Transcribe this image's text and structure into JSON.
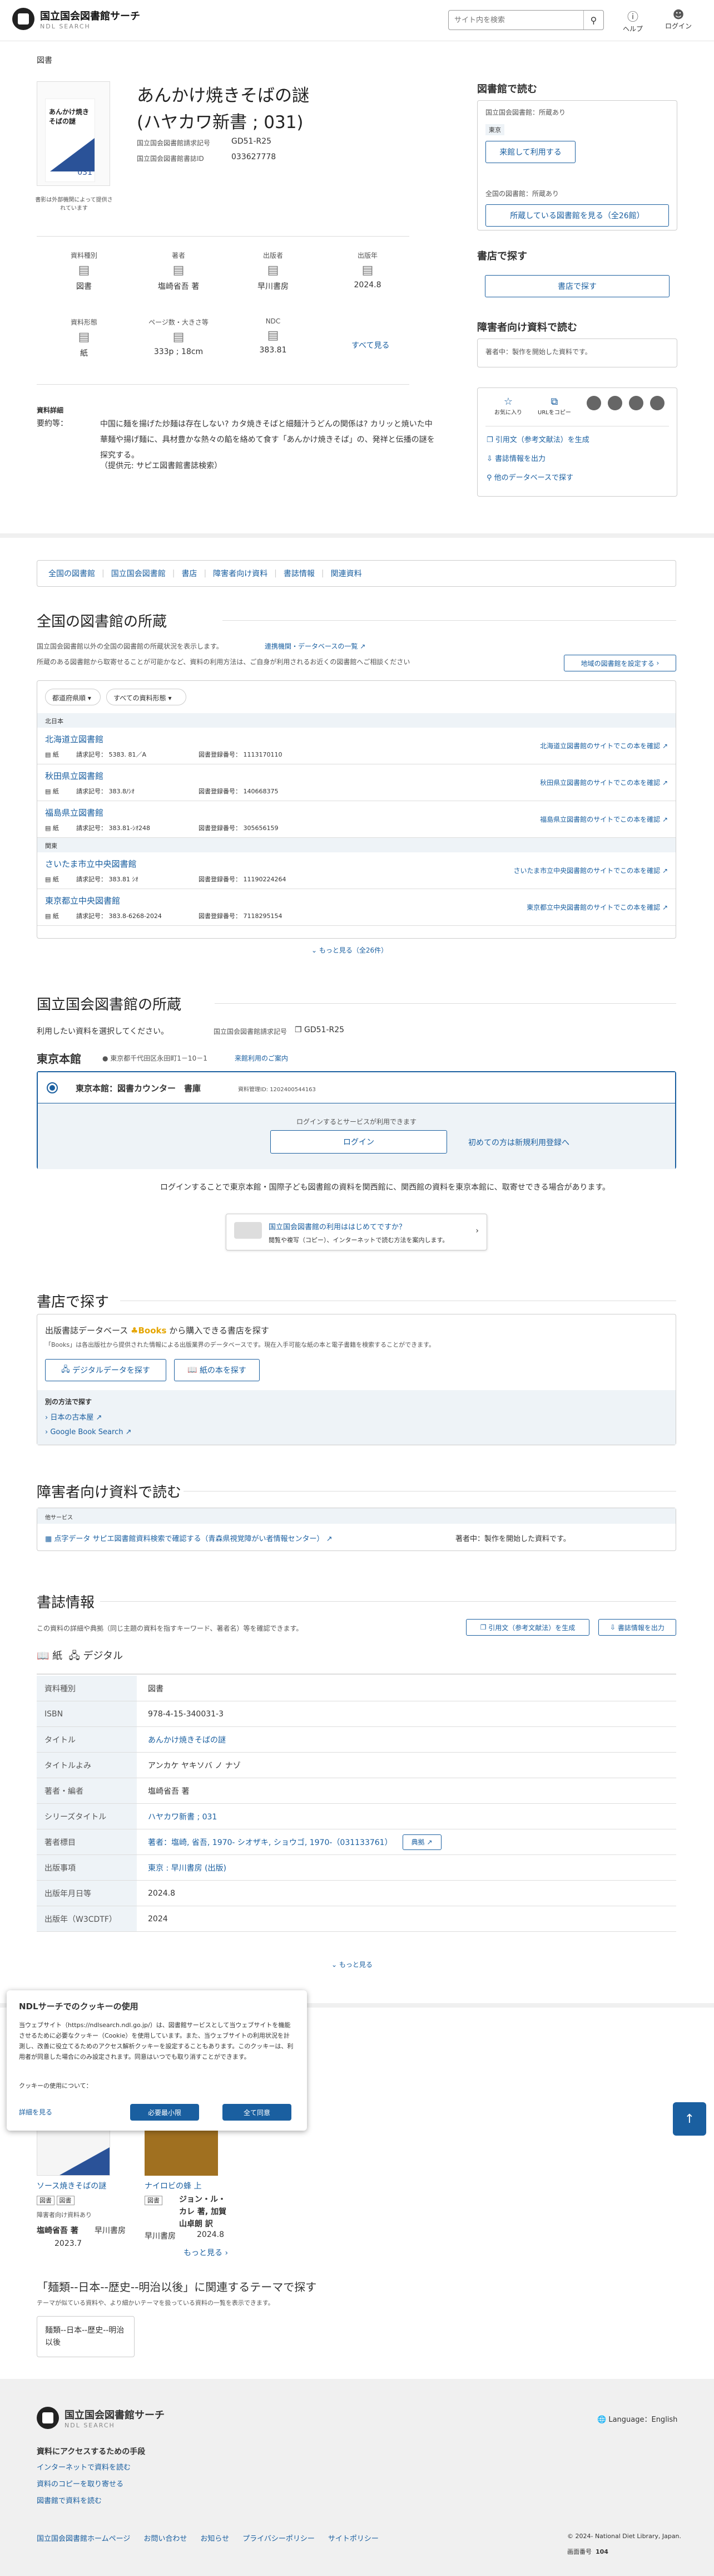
{
  "header": {
    "logo_title": "国立国会図書館サーチ",
    "logo_sub": "NDL SEARCH",
    "search_placeholder": "サイト内を検索",
    "help": "ヘルプ",
    "login": "ログイン"
  },
  "book": {
    "section_label": "図書",
    "title_line1": "あんかけ焼きそばの謎",
    "title_line2": "(ハヤカワ新書 ; 031)",
    "cover_text": "あんかけ焼きそばの謎",
    "cover_note": "書影は外部機関によって提供されています",
    "callno_label": "国立国会図書館請求記号",
    "callno": "GD51-R25",
    "bibno_label": "国立国会図書館書誌ID",
    "bibno": "033627778"
  },
  "facets": [
    {
      "label": "資料種別",
      "value": "図書"
    },
    {
      "label": "著者",
      "value": "塩崎省吾 著"
    },
    {
      "label": "出版者",
      "value": "早川書房"
    },
    {
      "label": "出版年",
      "value": "2024.8"
    }
  ],
  "facets2": [
    {
      "label": "資料形態",
      "value": "紙"
    },
    {
      "label": "ページ数・大きさ等",
      "value": "333p ; 18cm"
    },
    {
      "label": "NDC",
      "value": "383.81"
    }
  ],
  "see_all": "すべて見る",
  "detail": {
    "heading": "資料詳細",
    "summary_label": "要約等：",
    "summary": "中国に麺を揚げた炒麺は存在しない? カタ焼きそばと細麺汁うどんの関係は? カリッと焼いた中華麺や揚げ麺に、具材豊かな熱々の餡を絡めて食す「あんかけ焼きそば」の、発祥と伝播の謎を探究する。",
    "summary_src": "（提供元: サピエ図書館書誌検索）"
  },
  "side": {
    "read_ndl": "図書館で読む",
    "ndl_label": "国立国会図書館：所蔵あり",
    "tokyo": "東京",
    "use_btn": "来館して利用する",
    "nat_label": "全国の図書館：所蔵あり",
    "nat_btn": "所蔵している図書館を見る（全26館）",
    "shop_title": "書店で探す",
    "shop_btn": "書店で探す",
    "acc_title": "障害者向け資料で読む",
    "acc_text": "著者中：製作を開始した資料です。",
    "share1": "お気に入り",
    "share2": "URLをコピー",
    "cite": "引用文（参考文献法）を生成",
    "export": "書誌情報を出力",
    "other": "他のデータベースで探す"
  },
  "tabs": [
    "全国の図書館",
    "国立国会図書館",
    "書店",
    "障害者向け資料",
    "書誌情報",
    "関連資料"
  ],
  "national": {
    "heading": "全国の図書館の所蔵",
    "note1": "国立国会図書館以外の全国の図書館の所蔵状況を表示します。",
    "link": "連携機関・データベースの一覧",
    "note2": "所蔵のある図書館から取寄せることが可能かなど、資料の利用方法は、ご自身が利用されるお近くの図書館へご相談ください",
    "region_btn": "地域の図書館を設定する",
    "filter1": "都道府県順",
    "filter2": "すべての資料形態",
    "group1": "北日本",
    "group2": "関東",
    "check": "のサイトでこの本を確認",
    "more": "もっと見る（全26件）",
    "libs": [
      {
        "name": "北海道立図書館",
        "callno": "請求記号： 5383. 81／A",
        "regno": "図書登録番号： 1113170110",
        "site": "北海道立図書館"
      },
      {
        "name": "秋田県立図書館",
        "callno": "請求記号： 383.8/ｼｵ",
        "regno": "図書登録番号： 140668375",
        "site": "秋田県立図書館"
      },
      {
        "name": "福島県立図書館",
        "callno": "請求記号： 383.81-ｼｵ248",
        "regno": "図書登録番号： 305656159",
        "site": "福島県立図書館"
      },
      {
        "name": "さいたま市立中央図書館",
        "callno": "請求記号： 383.81 ｼｵ",
        "regno": "図書登録番号： 11190224264",
        "site": "さいたま市立中央図書館"
      },
      {
        "name": "東京都立中央図書館",
        "callno": "請求記号： 383.8-6268-2024",
        "regno": "図書登録番号： 7118295154",
        "site": "東京都立中央図書館"
      }
    ],
    "type_label": "紙"
  },
  "ndl": {
    "heading": "国立国会図書館の所蔵",
    "select": "利用したい資料を選択してください。",
    "callno_label": "国立国会図書館請求記号",
    "callno": "GD51-R25",
    "tokyo": "東京本館",
    "addr": "東京都千代田区永田町1－10－1",
    "guide": "来館利用のご案内",
    "counter": "東京本館：図書カウンター　書庫",
    "reg": "資料管理ID: 1202400544163",
    "login_note": "ログインするとサービスが利用できます",
    "login_btn": "ログイン",
    "register": "初めての方は新規利用登録へ",
    "info": "ログインすることで東京本館・国際子ども図書館の資料を関西館に、関西館の資料を東京本館に、取寄せできる場合があります。",
    "banner_t": "国立国会図書館の利用ははじめてですか？",
    "banner_s": "閲覧や複写（コピー）、インターネットで読む方法を案内します。"
  },
  "shop": {
    "heading": "書店で探す",
    "db_label": "出版書誌データベース",
    "books": "Books",
    "db_suffix": "から購入できる書店を探す",
    "note": "「Books」は各出版社から提供された情報による出版業界のデータベースです。現在入手可能な紙の本と電子書籍を検索することができます。",
    "digital": "デジタルデータを探す",
    "paper": "紙の本を探す",
    "other": "別の方法で探す",
    "link1": "日本の古本屋",
    "link2": "Google Book Search"
  },
  "acc": {
    "heading": "障害者向け資料で読む",
    "sub": "他サービス",
    "link": "点字データ サピエ図書館資料検索で確認する（青森県視覚障がい者情報センター）",
    "text": "著者中：製作を開始した資料です。"
  },
  "biblio": {
    "heading": "書誌情報",
    "note": "この資料の詳細や典拠（同じ主題の資料を指すキーワード、著者名）等を確認できます。",
    "cite": "引用文（参考文献法）を生成",
    "export": "書誌情報を出力",
    "tab_paper": "紙",
    "tab_digital": "デジタル",
    "more": "もっと見る",
    "rows": [
      {
        "k": "資料種別",
        "v": "図書"
      },
      {
        "k": "ISBN",
        "v": "978-4-15-340031-3"
      },
      {
        "k": "タイトル",
        "v": "あんかけ焼きそばの謎"
      },
      {
        "k": "タイトルよみ",
        "v": "アンカケ ヤキソバ ノ ナゾ"
      },
      {
        "k": "著者・編者",
        "v": "塩崎省吾 著"
      },
      {
        "k": "シリーズタイトル",
        "v": "ハヤカワ新書 ; 031"
      },
      {
        "k": "著者標目",
        "v": "著者：塩崎, 省吾, 1970- シオザキ, ショウゴ, 1970-（031133761）"
      },
      {
        "k": "出版事項",
        "v": "東京 : 早川書房 (出版)"
      },
      {
        "k": "出版年月日等",
        "v": "2024.8"
      },
      {
        "k": "出版年（W3CDTF）",
        "v": "2024"
      }
    ],
    "identity": "典拠"
  },
  "related": {
    "book1": "ソース焼きそばの謎",
    "book2": "ナイロビの蜂 上",
    "b1_type": "図書",
    "b1_type2": "図書",
    "b1_note": "障害者向け資料あり",
    "b1_author": "塩崎省吾 著",
    "b1_pub": "早川書房",
    "b1_year": "2023.7",
    "b2_type": "図書",
    "b2_author": "ジョン・ル・カレ 著, 加賀山卓朗 訳",
    "b2_pub": "早川書房",
    "b2_year": "2024.8",
    "more": "もっと見る"
  },
  "theme": {
    "heading": "「麺類--日本--歴史--明治以後」に関連するテーマで探す",
    "note": "テーマが似ている資料や、より細かいテーマを扱っている資料の一覧を表示できます。",
    "card": "麺類--日本--歴史--明治以後"
  },
  "cookie": {
    "title": "NDLサーチでのクッキーの使用",
    "body": "当ウェブサイト（https://ndlsearch.ndl.go.jp/）は、図書館サービスとして当ウェブサイトを機能させるために必要なクッキー（Cookie）を使用しています。また、当ウェブサイトの利用状況を計測し、改善に役立てるためのアクセス解析クッキーを設定することもあります。このクッキーは、利用者が同意した場合にのみ設定されます。同意はいつでも取り消すことができます。",
    "use": "クッキーの使用について：",
    "detail": "詳細を見る",
    "necessary": "必要最小限",
    "accept": "全て同意"
  },
  "footer": {
    "title": "国立国会図書館サーチ",
    "sub": "NDL SEARCH",
    "lang": "Language：English",
    "means": "資料にアクセスするための手段",
    "l1": "インターネットで資料を読む",
    "l2": "資料のコピーを取り寄せる",
    "l3": "図書館で資料を読む",
    "links": [
      "国立国会図書館ホームページ",
      "お問い合わせ",
      "お知らせ",
      "プライバシーポリシー",
      "サイトポリシー"
    ],
    "copy": "© 2024- National Diet Library, Japan.",
    "pageno_label": "画面番号",
    "pageno": "104"
  }
}
